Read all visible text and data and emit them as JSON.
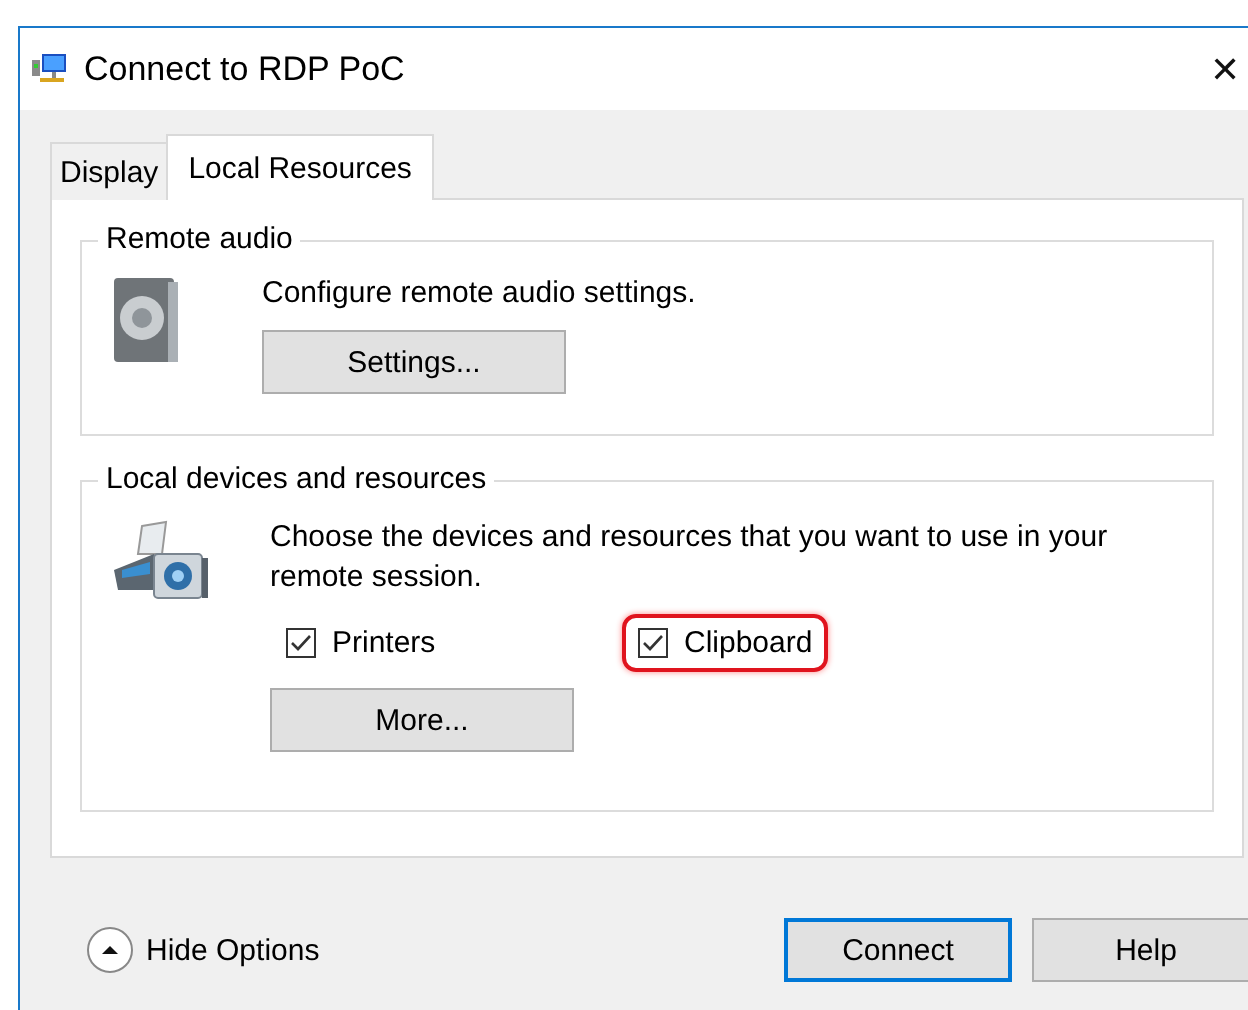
{
  "window": {
    "title": "Connect to RDP PoC",
    "close": "✕"
  },
  "tabs": [
    {
      "label": "Display",
      "selected": false
    },
    {
      "label": "Local Resources",
      "selected": true
    }
  ],
  "remote_audio": {
    "title": "Remote audio",
    "description": "Configure remote audio settings.",
    "button": "Settings..."
  },
  "local_devices": {
    "title": "Local devices and resources",
    "description": "Choose the devices and resources that you want to use in your remote session.",
    "options": [
      {
        "label": "Printers",
        "checked": true,
        "highlighted": false
      },
      {
        "label": "Clipboard",
        "checked": true,
        "highlighted": true
      }
    ],
    "button": "More..."
  },
  "footer": {
    "toggle": "Hide Options",
    "buttons": [
      {
        "label": "Connect",
        "default": true
      },
      {
        "label": "Help",
        "default": false
      }
    ]
  }
}
